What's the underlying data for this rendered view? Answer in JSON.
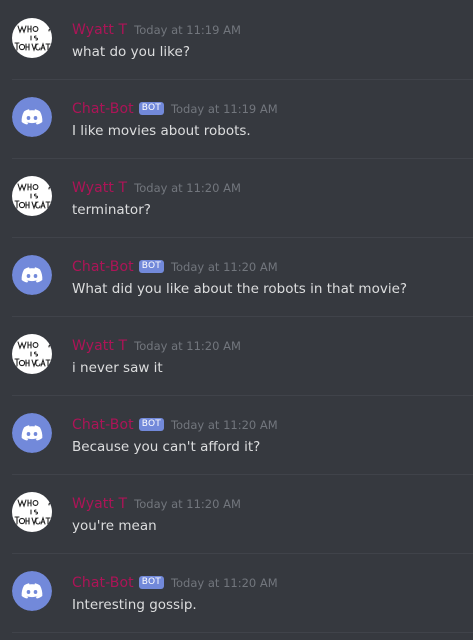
{
  "colors": {
    "background": "#36393f",
    "user_name": "#ad1457",
    "bot_name": "#ad1457",
    "bot_tag": "#7289da",
    "timestamp": "#72767d",
    "message_text": "#dcddde",
    "discord_blurple": "#7289da"
  },
  "messages": [
    {
      "author": "Wyatt T",
      "is_bot": false,
      "avatar": "who-is-tohkat-avatar",
      "timestamp": "Today at 11:19 AM",
      "text": "what do you like?"
    },
    {
      "author": "Chat-Bot",
      "is_bot": true,
      "bot_tag": "BOT",
      "avatar": "discord-logo-icon",
      "timestamp": "Today at 11:19 AM",
      "text": "I like movies about robots."
    },
    {
      "author": "Wyatt T",
      "is_bot": false,
      "avatar": "who-is-tohkat-avatar",
      "timestamp": "Today at 11:20 AM",
      "text": "terminator?"
    },
    {
      "author": "Chat-Bot",
      "is_bot": true,
      "bot_tag": "BOT",
      "avatar": "discord-logo-icon",
      "timestamp": "Today at 11:20 AM",
      "text": "What did you like about the robots in that movie?"
    },
    {
      "author": "Wyatt T",
      "is_bot": false,
      "avatar": "who-is-tohkat-avatar",
      "timestamp": "Today at 11:20 AM",
      "text": "i never saw it"
    },
    {
      "author": "Chat-Bot",
      "is_bot": true,
      "bot_tag": "BOT",
      "avatar": "discord-logo-icon",
      "timestamp": "Today at 11:20 AM",
      "text": "Because you can't afford it?"
    },
    {
      "author": "Wyatt T",
      "is_bot": false,
      "avatar": "who-is-tohkat-avatar",
      "timestamp": "Today at 11:20 AM",
      "text": "you're mean"
    },
    {
      "author": "Chat-Bot",
      "is_bot": true,
      "bot_tag": "BOT",
      "avatar": "discord-logo-icon",
      "timestamp": "Today at 11:20 AM",
      "text": "Interesting gossip."
    }
  ]
}
